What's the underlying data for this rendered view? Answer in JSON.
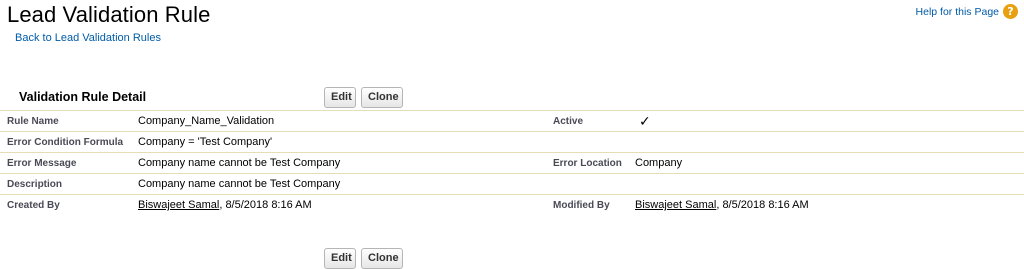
{
  "header": {
    "title": "Lead Validation Rule",
    "back_link": "Back to Lead Validation Rules",
    "help_link": "Help for this Page",
    "help_icon": "question-mark-icon"
  },
  "section": {
    "title": "Validation Rule Detail",
    "edit_label": "Edit",
    "clone_label": "Clone"
  },
  "fields": {
    "rule_name_label": "Rule Name",
    "rule_name_value": "Company_Name_Validation",
    "active_label": "Active",
    "active_value": "✓",
    "formula_label": "Error Condition Formula",
    "formula_value": "Company = 'Test Company'",
    "error_message_label": "Error Message",
    "error_message_value": "Company name cannot be Test Company",
    "error_location_label": "Error Location",
    "error_location_value": "Company",
    "description_label": "Description",
    "description_value": "Company name cannot be Test Company",
    "created_by_label": "Created By",
    "created_by_user": "Biswajeet Samal",
    "created_by_date": ", 8/5/2018 8:16 AM",
    "modified_by_label": "Modified By",
    "modified_by_user": "Biswajeet Samal",
    "modified_by_date": ", 8/5/2018 8:16 AM"
  },
  "colors": {
    "link": "#015ba7",
    "help_icon": "#e8a010",
    "row_border": "#e3deb8"
  }
}
